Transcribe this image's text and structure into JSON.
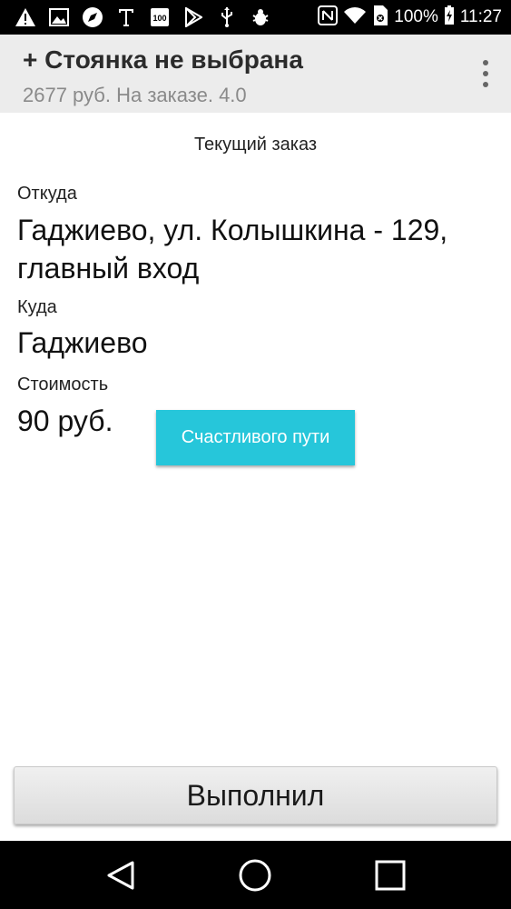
{
  "status_bar": {
    "battery_percent": "100%",
    "time": "11:27",
    "left_icons": [
      "warning-icon",
      "image-icon",
      "compass-icon",
      "text-icon",
      "badge-100-icon",
      "play-store-icon",
      "usb-icon",
      "bug-icon"
    ],
    "right_icons": [
      "nfc-icon",
      "wifi-icon",
      "sim-off-icon",
      "battery-icon"
    ]
  },
  "app_bar": {
    "title": "+ Стоянка не выбрана",
    "subtitle": "2677 руб. На заказе. 4.0",
    "menu_icon": "more-vert-icon"
  },
  "order": {
    "section_title": "Текущий заказ",
    "from_label": "Откуда",
    "from_value": "Гаджиево, ул. Колышкина - 129, главный вход",
    "to_label": "Куда",
    "to_value": "Гаджиево",
    "cost_label": "Стоимость",
    "cost_value": "90 руб.",
    "bon_voyage_label": "Счастливого пути"
  },
  "actions": {
    "done_label": "Выполнил"
  },
  "colors": {
    "accent": "#26c6da",
    "app_bar_bg": "#ececec"
  },
  "nav_bar": {
    "icons": [
      "back-icon",
      "home-icon",
      "recents-icon"
    ]
  }
}
